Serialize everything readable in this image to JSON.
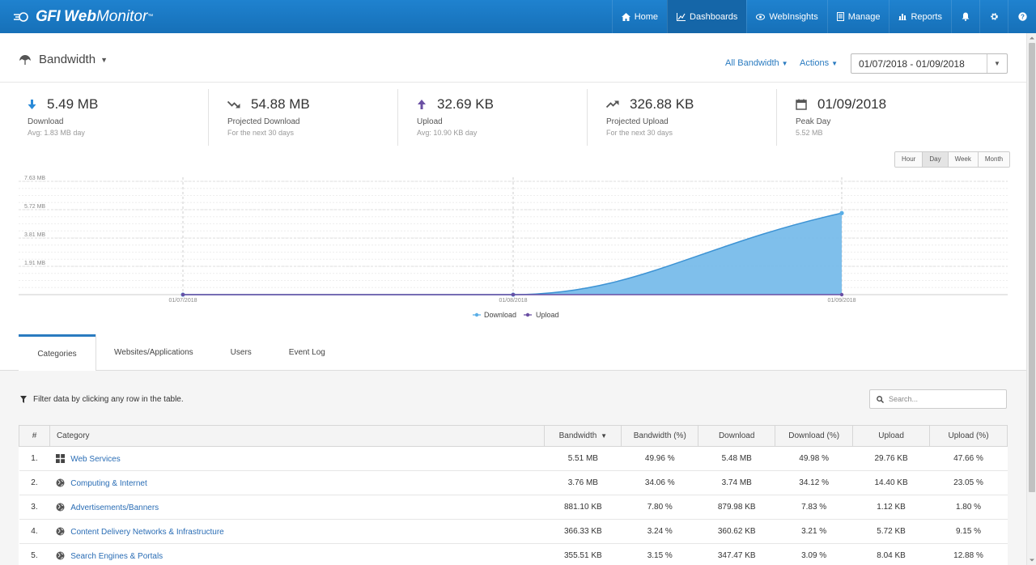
{
  "brand": {
    "part1": "GFI",
    "part2": "Web",
    "part3": "Monitor",
    "tm": "™"
  },
  "nav": [
    {
      "label": "Home",
      "icon": "home-icon"
    },
    {
      "label": "Dashboards",
      "icon": "chart-line-icon"
    },
    {
      "label": "WebInsights",
      "icon": "eye-icon"
    },
    {
      "label": "Manage",
      "icon": "document-icon"
    },
    {
      "label": "Reports",
      "icon": "bar-chart-icon"
    }
  ],
  "page": {
    "title": "Bandwidth"
  },
  "filters": {
    "bandwidth": "All Bandwidth",
    "actions": "Actions"
  },
  "date_range": "01/07/2018 - 01/09/2018",
  "stats": [
    {
      "value": "5.49 MB",
      "label": "Download",
      "sub": "Avg: 1.83 MB day",
      "icon": "arrow-down-icon"
    },
    {
      "value": "54.88 MB",
      "label": "Projected Download",
      "sub": "For the next 30 days",
      "icon": "trend-down-icon"
    },
    {
      "value": "32.69 KB",
      "label": "Upload",
      "sub": "Avg: 10.90 KB day",
      "icon": "arrow-up-icon"
    },
    {
      "value": "326.88 KB",
      "label": "Projected Upload",
      "sub": "For the next 30 days",
      "icon": "trend-up-icon"
    },
    {
      "value": "01/09/2018",
      "label": "Peak Day",
      "sub": "5.52 MB",
      "icon": "calendar-icon"
    }
  ],
  "range_buttons": [
    "Hour",
    "Day",
    "Week",
    "Month"
  ],
  "range_selected": "Day",
  "chart_data": {
    "type": "area",
    "x": [
      "01/07/2018",
      "01/08/2018",
      "01/09/2018"
    ],
    "y_ticks": [
      "7.63 MB",
      "5.72 MB",
      "3.81 MB",
      "1.91 MB"
    ],
    "y_tick_values": [
      7.63,
      5.72,
      3.81,
      1.91
    ],
    "ylim": [
      0,
      7.63
    ],
    "series": [
      {
        "name": "Download",
        "values": [
          0,
          0,
          5.49
        ],
        "color": "#5aaee6"
      },
      {
        "name": "Upload",
        "values": [
          0,
          0,
          0.03
        ],
        "color": "#6a4fa3"
      }
    ],
    "legend": "bottom-center",
    "grid": true
  },
  "tabs": [
    "Categories",
    "Websites/Applications",
    "Users",
    "Event Log"
  ],
  "active_tab": "Categories",
  "hint": "Filter data by clicking any row in the table.",
  "search": {
    "placeholder": "Search..."
  },
  "table": {
    "columns": [
      "#",
      "Category",
      "Bandwidth",
      "Bandwidth (%)",
      "Download",
      "Download (%)",
      "Upload",
      "Upload (%)"
    ],
    "rows": [
      {
        "n": "1.",
        "icon": "grid-icon",
        "category": "Web Services",
        "bandwidth": "5.51 MB",
        "bandwidth_pct": "49.96 %",
        "download": "5.48 MB",
        "download_pct": "49.98 %",
        "upload": "29.76 KB",
        "upload_pct": "47.66 %"
      },
      {
        "n": "2.",
        "icon": "globe-icon",
        "category": "Computing & Internet",
        "bandwidth": "3.76 MB",
        "bandwidth_pct": "34.06 %",
        "download": "3.74 MB",
        "download_pct": "34.12 %",
        "upload": "14.40 KB",
        "upload_pct": "23.05 %"
      },
      {
        "n": "3.",
        "icon": "globe-icon",
        "category": "Advertisements/Banners",
        "bandwidth": "881.10 KB",
        "bandwidth_pct": "7.80 %",
        "download": "879.98 KB",
        "download_pct": "7.83 %",
        "upload": "1.12 KB",
        "upload_pct": "1.80 %"
      },
      {
        "n": "4.",
        "icon": "globe-icon",
        "category": "Content Delivery Networks & Infrastructure",
        "bandwidth": "366.33 KB",
        "bandwidth_pct": "3.24 %",
        "download": "360.62 KB",
        "download_pct": "3.21 %",
        "upload": "5.72 KB",
        "upload_pct": "9.15 %"
      },
      {
        "n": "5.",
        "icon": "globe-icon",
        "category": "Search Engines & Portals",
        "bandwidth": "355.51 KB",
        "bandwidth_pct": "3.15 %",
        "download": "347.47 KB",
        "download_pct": "3.09 %",
        "upload": "8.04 KB",
        "upload_pct": "12.88 %"
      }
    ]
  }
}
